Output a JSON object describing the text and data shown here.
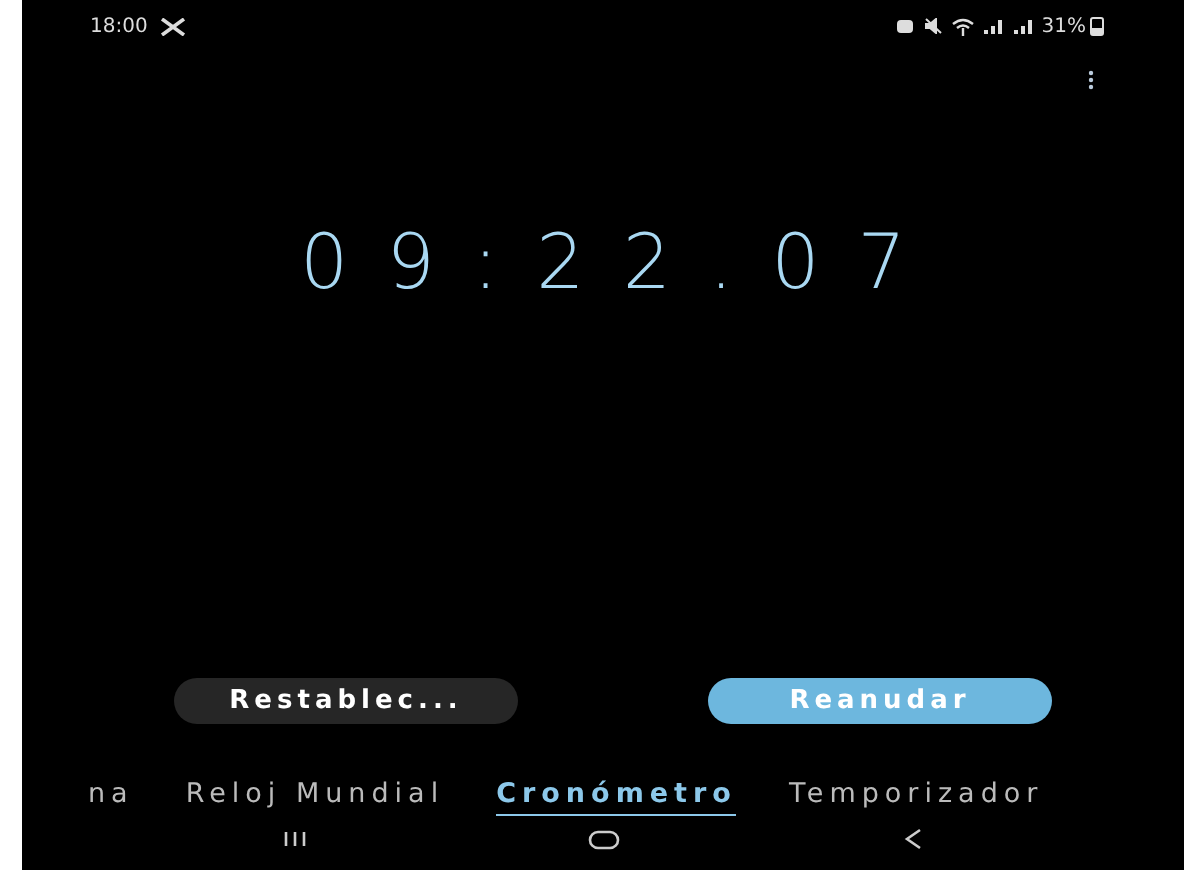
{
  "status_bar": {
    "time": "18:00",
    "battery": "31%"
  },
  "stopwatch": {
    "time": "09:22.07"
  },
  "buttons": [
    {
      "label": "Restablec...",
      "kind": "secondary"
    },
    {
      "label": "Reanudar",
      "kind": "primary"
    }
  ],
  "tabs": [
    {
      "label": "na",
      "selected": false
    },
    {
      "label": "Reloj Mundial",
      "selected": false
    },
    {
      "label": "Cronómetro",
      "selected": true
    },
    {
      "label": "Temporizador",
      "selected": false
    }
  ]
}
